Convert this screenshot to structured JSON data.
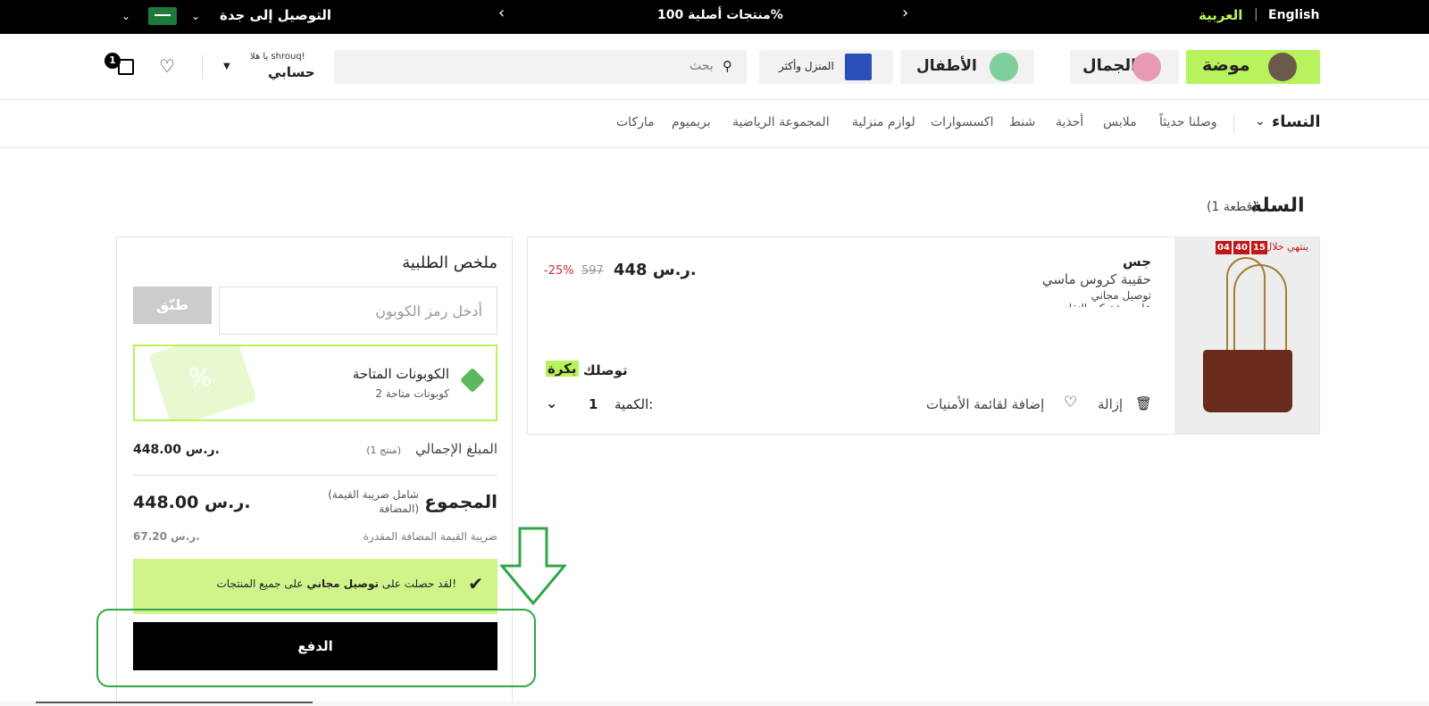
{
  "topbar": {
    "lang_en": "English",
    "separator": "|",
    "lang_ar": "العربية",
    "promo": "منتجات أصلية 100%",
    "deliver": "التوصيل إلى جدة",
    "prev_icon": "chevron-left-icon",
    "next_icon": "chevron-right-icon"
  },
  "header": {
    "categories": [
      {
        "label": "موضة"
      },
      {
        "label": "الجمال"
      },
      {
        "label": "الأطفال"
      },
      {
        "label": "المنزل وأكثر"
      }
    ],
    "search": {
      "placeholder": "بحث"
    },
    "account": {
      "greeting": "يا هلا shrouq!",
      "label": "حسابي"
    },
    "cart_count": "1"
  },
  "nav": {
    "women": "النساء",
    "items": [
      "وصلنا حديثاً",
      "ملابس",
      "أحذية",
      "شنط",
      "اكسسوارات",
      "لوازم منزلية",
      "المجموعة الرياضية",
      "بريميوم",
      "ماركات"
    ]
  },
  "cart": {
    "title": "السلة",
    "count": "(1 قطعة)",
    "item": {
      "timer_label": "ينتهي خلال",
      "timer": [
        "15",
        "40",
        "04"
      ],
      "brand": "جس",
      "name": "حقيبة كروس ماسي",
      "cut_text": "توصيل مجاني\nعلى مشتركي النقاد",
      "price": "448 ر.س.",
      "old_price": "597",
      "discount": "-25%",
      "delivery_text": "توصلك",
      "delivery_highlight": "بكرة",
      "qty_label": "الكمية:",
      "qty_value": "1",
      "remove": "إزالة",
      "wishlist": "إضافة لقائمة الأمنيات"
    }
  },
  "summary": {
    "title": "ملخص الطلبية",
    "coupon_placeholder": "أدخل رمز الكوبون",
    "apply": "طبّق",
    "available_title": "الكوبونات المتاحة",
    "available_sub": "2 كوبونات متاحة",
    "subtotal_label": "المبلغ الإجمالي",
    "subtotal_count": "(1 منتج)",
    "subtotal_value": "448.00 ر.س.",
    "total_label": "المجموع",
    "total_note": "(شامل ضريبة القيمة المضافة)",
    "total_value": "448.00 ر.س.",
    "vat_label": "ضريبة القيمة المضافة المقدرة",
    "vat_value": "67.20 ر.س.",
    "free_pre": "لقد حصلت على",
    "free_bold": "توصيل مجاني",
    "free_post": "على جميع المنتجات!",
    "pay": "الدفع"
  },
  "colors": {
    "accent": "#b8f25c",
    "annotation": "#2fa64a",
    "discount": "#d0283c"
  }
}
